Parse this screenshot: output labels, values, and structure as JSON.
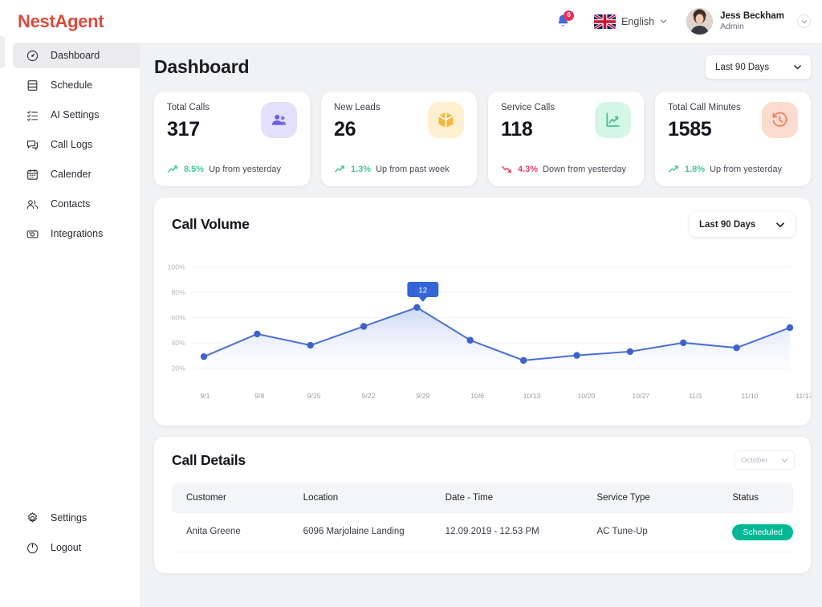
{
  "brand": {
    "name": "NestAgent"
  },
  "sidebar": {
    "items": [
      {
        "label": "Dashboard",
        "icon": "gauge-icon",
        "active": true
      },
      {
        "label": "Schedule",
        "icon": "list-panel-icon",
        "active": false
      },
      {
        "label": "AI Settings",
        "icon": "checklist-icon",
        "active": false
      },
      {
        "label": "Call Logs",
        "icon": "chat-bubble-icon",
        "active": false
      },
      {
        "label": "Calender",
        "icon": "calendar-icon",
        "active": false
      },
      {
        "label": "Contacts",
        "icon": "people-icon",
        "active": false
      },
      {
        "label": "Integrations",
        "icon": "camera-icon",
        "active": false
      }
    ],
    "bottom_items": [
      {
        "label": "Settings",
        "icon": "gear-icon"
      },
      {
        "label": "Logout",
        "icon": "power-icon"
      }
    ]
  },
  "topbar": {
    "notification_count": "6",
    "notification_icon": "bell-icon",
    "language": "English",
    "flag": "uk-flag-icon",
    "user_name": "Jess Beckham",
    "user_role": "Admin",
    "avatar": "user-avatar"
  },
  "page": {
    "title": "Dashboard",
    "range_selected": "Last 90 Days"
  },
  "stats": [
    {
      "label": "Total Calls",
      "value": "317",
      "delta": "8.5%",
      "delta_text": "Up from yesterday",
      "direction": "up",
      "delta_color": "#3fc8a0",
      "icon": "people-group-icon",
      "icon_bg": "#e2e0fb",
      "icon_fg": "#6b5ce7"
    },
    {
      "label": "New Leads",
      "value": "26",
      "delta": "1.3%",
      "delta_text": "Up from past week",
      "direction": "up",
      "delta_color": "#3fc8a0",
      "icon": "box-cube-icon",
      "icon_bg": "#fdf0d0",
      "icon_fg": "#f4b740"
    },
    {
      "label": "Service Calls",
      "value": "118",
      "delta": "4.3%",
      "delta_text": "Down from yesterday",
      "direction": "down",
      "delta_color": "#e8426a",
      "icon": "line-chart-icon",
      "icon_bg": "#d6f6e5",
      "icon_fg": "#3fc88a"
    },
    {
      "label": "Total Call Minutes",
      "value": "1585",
      "delta": "1.8%",
      "delta_text": "Up from yesterday",
      "direction": "up",
      "delta_color": "#3fc8a0",
      "icon": "history-clock-icon",
      "icon_bg": "#fbdcce",
      "icon_fg": "#f0825c"
    }
  ],
  "chart_panel": {
    "title": "Call Volume",
    "range_selected": "Last 90 Days"
  },
  "chart_data": {
    "type": "area",
    "title": "Call Volume",
    "xlabel": "",
    "ylabel": "",
    "ylim": [
      10,
      110
    ],
    "ytick_labels": [
      "100%",
      "80%",
      "60%",
      "40%",
      "20%"
    ],
    "yticks": [
      100,
      80,
      60,
      40,
      20
    ],
    "grid": true,
    "legend": "none",
    "line_color": "#4a6fd4",
    "point_color": "#3c62cf",
    "fill_from": "#c8d6f5",
    "fill_to": "#ffffff",
    "categories": [
      "9/1",
      "9/8",
      "9/15",
      "9/22",
      "9/29",
      "10/6",
      "10/13",
      "10/20",
      "10/27",
      "11/3",
      "11/10",
      "11/17"
    ],
    "values": [
      29,
      47,
      38,
      53,
      68,
      42,
      26,
      30,
      33,
      40,
      36,
      52
    ],
    "tooltip": {
      "label": "12",
      "at_category": "9/29",
      "value": 68
    }
  },
  "table_panel": {
    "title": "Call Details",
    "month_selected": "October",
    "columns": [
      "Customer",
      "Location",
      "Date - Time",
      "Service Type",
      "Status"
    ],
    "rows": [
      {
        "customer": "Anita Greene",
        "location": "6096 Marjolaine Landing",
        "datetime": "12.09.2019 - 12.53 PM",
        "service_type": "AC Tune-Up",
        "status": "Scheduled",
        "status_color": "#00b894"
      }
    ]
  }
}
